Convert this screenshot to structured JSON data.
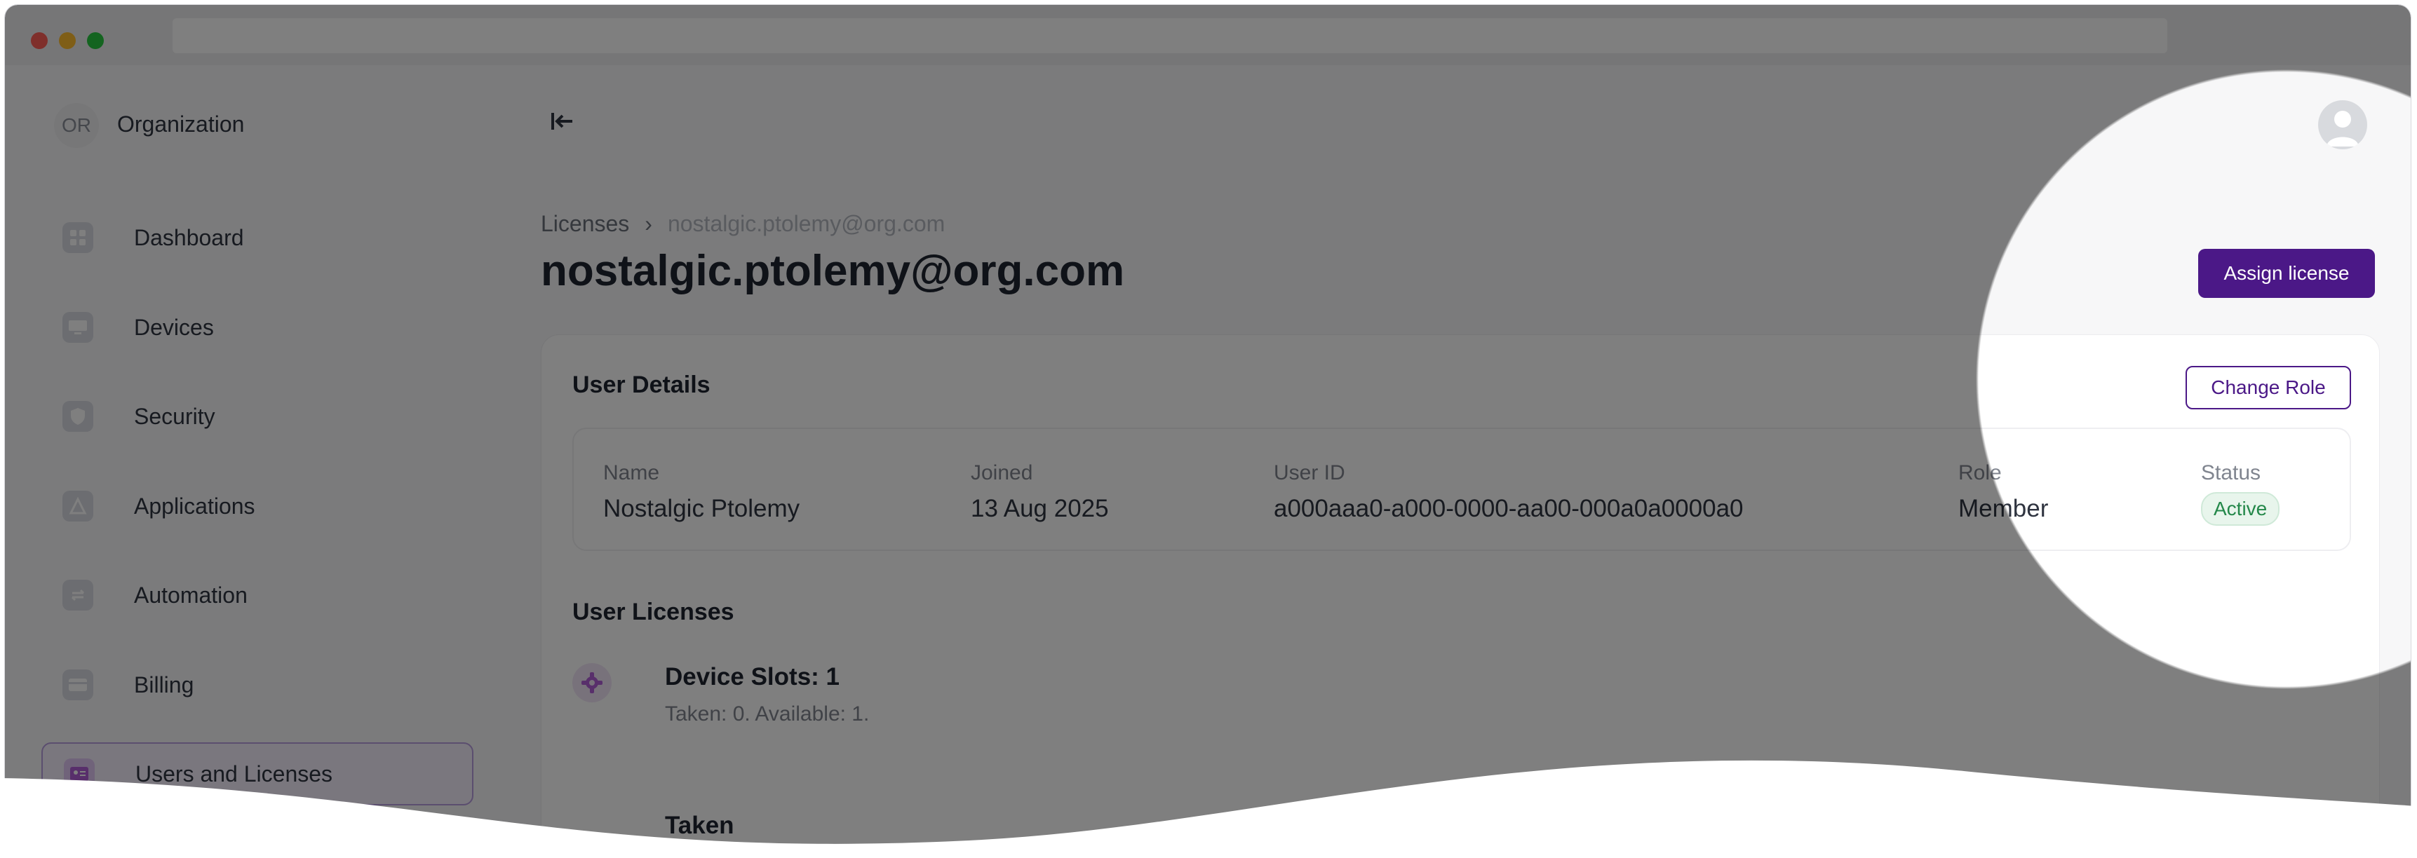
{
  "sidebar": {
    "org_initials": "OR",
    "org_name": "Organization",
    "items": [
      {
        "label": "Dashboard",
        "icon": "dashboard-icon"
      },
      {
        "label": "Devices",
        "icon": "devices-icon"
      },
      {
        "label": "Security",
        "icon": "shield-icon"
      },
      {
        "label": "Applications",
        "icon": "applications-icon"
      },
      {
        "label": "Automation",
        "icon": "automation-icon"
      },
      {
        "label": "Billing",
        "icon": "billing-icon"
      },
      {
        "label": "Users and Licenses",
        "icon": "users-icon",
        "active": true
      }
    ]
  },
  "header": {
    "collapse_icon": "collapse-sidebar-icon",
    "avatar_icon": "user-avatar-icon"
  },
  "breadcrumb": {
    "parent": "Licenses",
    "separator": "›",
    "current": "nostalgic.ptolemy@org.com"
  },
  "page": {
    "title": "nostalgic.ptolemy@org.com",
    "assign_button": "Assign license"
  },
  "user_details": {
    "title": "User Details",
    "change_role_button": "Change Role",
    "fields": {
      "name_label": "Name",
      "name_value": "Nostalgic Ptolemy",
      "joined_label": "Joined",
      "joined_value": "13 Aug 2025",
      "user_id_label": "User ID",
      "user_id_value": "a000aaa0-a000-0000-aa00-000a0a0000a0",
      "role_label": "Role",
      "role_value": "Member",
      "status_label": "Status",
      "status_value": "Active"
    }
  },
  "user_licenses": {
    "title": "User Licenses",
    "license_icon": "gear-icon",
    "license_title": "Device Slots: 1",
    "license_sub": "Taken: 0. Available: 1.",
    "taken_title": "Taken"
  },
  "colors": {
    "primary": "#4b1887",
    "active_badge": "#24884a",
    "active_nav_border": "#b79cdf"
  }
}
